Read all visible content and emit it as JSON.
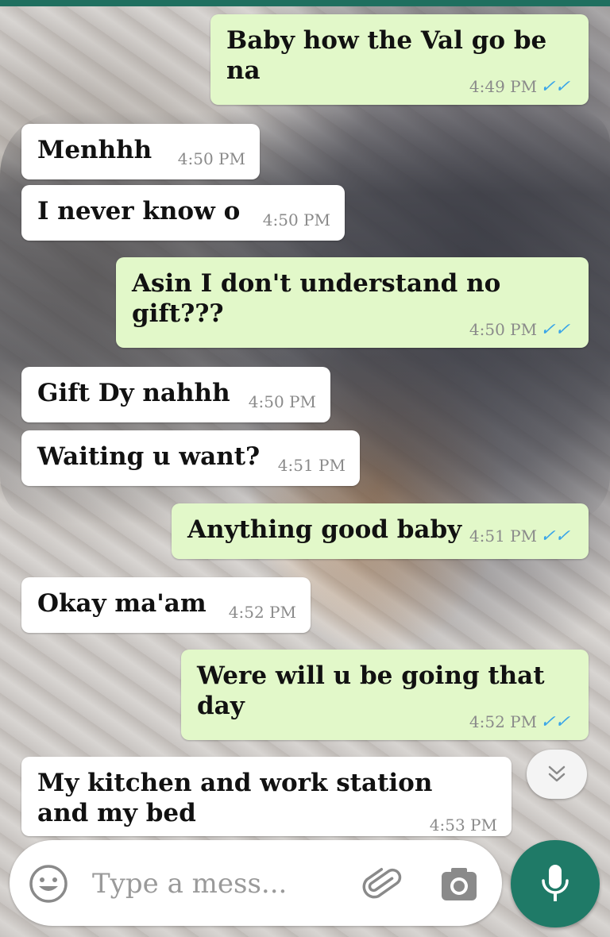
{
  "chat": {
    "messages": [
      {
        "direction": "outgoing",
        "text": "Baby how the Val go be na",
        "time": "4:49 PM",
        "status": "read"
      },
      {
        "direction": "incoming",
        "text": "Menhhh",
        "time": "4:50 PM"
      },
      {
        "direction": "incoming",
        "text": "I never know o",
        "time": "4:50 PM"
      },
      {
        "direction": "outgoing",
        "text": "Asin I don't understand no gift???",
        "time": "4:50 PM",
        "status": "read"
      },
      {
        "direction": "incoming",
        "text": "Gift Dy nahhh",
        "time": "4:50 PM"
      },
      {
        "direction": "incoming",
        "text": "Waiting u want?",
        "time": "4:51 PM"
      },
      {
        "direction": "outgoing",
        "text": "Anything good baby",
        "time": "4:51 PM",
        "status": "read"
      },
      {
        "direction": "incoming",
        "text": "Okay ma'am",
        "time": "4:52 PM"
      },
      {
        "direction": "outgoing",
        "text": "Were will u be going that day",
        "time": "4:52 PM",
        "status": "read"
      },
      {
        "direction": "incoming",
        "text": "My kitchen and work station and my bed",
        "time": "4:53 PM"
      }
    ],
    "read_tick_glyph": "✓✓",
    "colors": {
      "outgoing_bubble": "#e2f8c9",
      "incoming_bubble": "#ffffff",
      "read_ticks": "#3aa5e8",
      "mic_button": "#1f7a67"
    }
  },
  "composer": {
    "placeholder": "Type a mess...",
    "icons": {
      "emoji": "smiley-face-icon",
      "attach": "paperclip-icon",
      "camera": "camera-icon",
      "mic": "microphone-icon",
      "scroll_down": "double-chevron-down-icon"
    }
  }
}
